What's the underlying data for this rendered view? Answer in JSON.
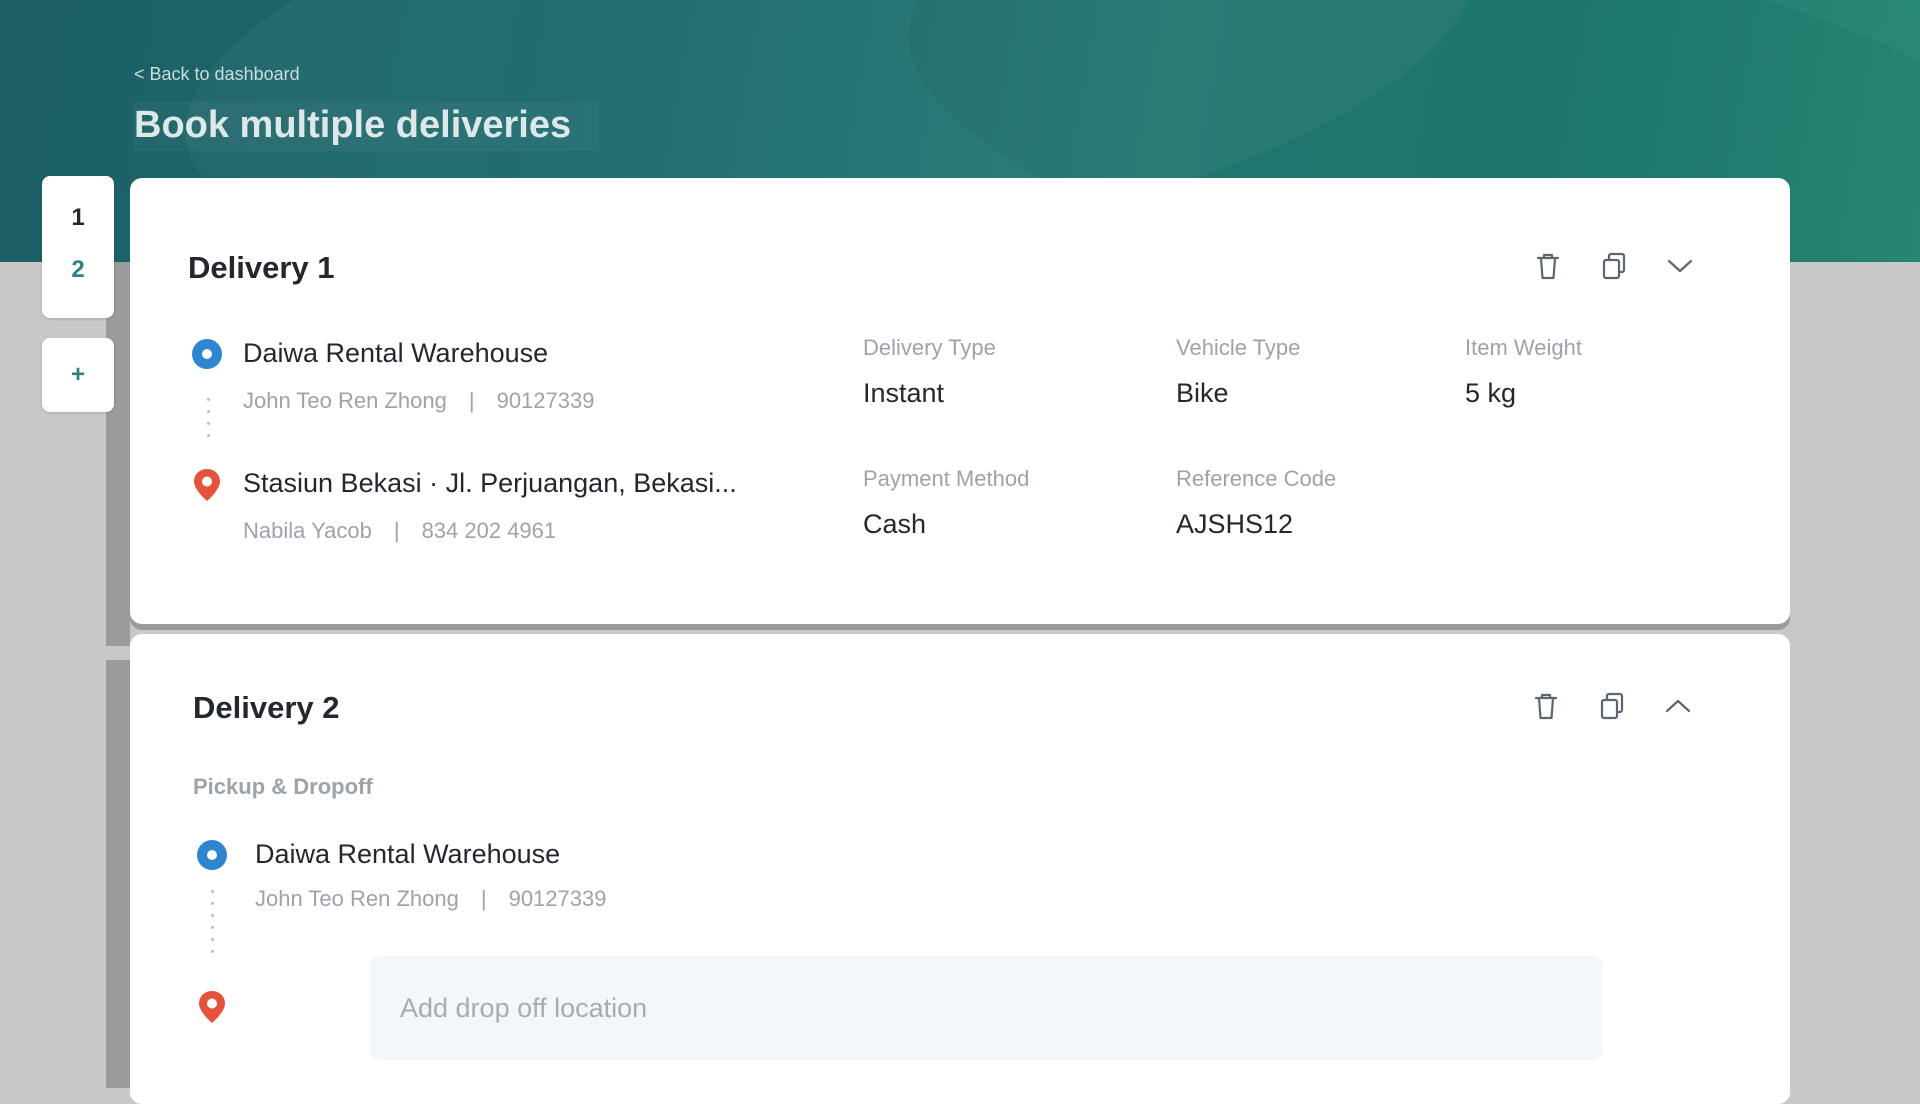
{
  "header": {
    "back_link": "< Back to dashboard",
    "title": "Book multiple deliveries"
  },
  "stepper": {
    "steps": [
      "1",
      "2"
    ],
    "add_label": "+"
  },
  "colors": {
    "header_gradient_start": "#1d5f66",
    "header_gradient_end": "#2a8a78",
    "pickup_marker": "#2e86d0",
    "dropoff_marker": "#e5533d",
    "accent": "#2f7f86"
  },
  "icons": [
    "trash-icon",
    "copy-icon",
    "chevron-down-icon",
    "chevron-up-icon",
    "pickup-marker-icon",
    "dropoff-pin-icon"
  ],
  "delivery1": {
    "title": "Delivery 1",
    "pickup": {
      "name": "Daiwa Rental Warehouse",
      "contact_name": "John Teo Ren Zhong",
      "separator": "|",
      "phone": "90127339"
    },
    "dropoff": {
      "name": "Stasiun Bekasi · Jl. Perjuangan, Bekasi...",
      "contact_name": "Nabila Yacob",
      "separator": "|",
      "phone": "834 202 4961"
    },
    "details": {
      "delivery_type_label": "Delivery Type",
      "delivery_type": "Instant",
      "vehicle_type_label": "Vehicle Type",
      "vehicle_type": "Bike",
      "item_weight_label": "Item Weight",
      "item_weight": "5 kg",
      "payment_method_label": "Payment Method",
      "payment_method": "Cash",
      "reference_code_label": "Reference Code",
      "reference_code": "AJSHS12"
    }
  },
  "delivery2": {
    "title": "Delivery 2",
    "section_label": "Pickup & Dropoff",
    "pickup": {
      "name": "Daiwa Rental Warehouse",
      "contact_name": "John Teo Ren Zhong",
      "separator": "|",
      "phone": "90127339"
    },
    "dropoff_placeholder": "Add drop off location"
  }
}
